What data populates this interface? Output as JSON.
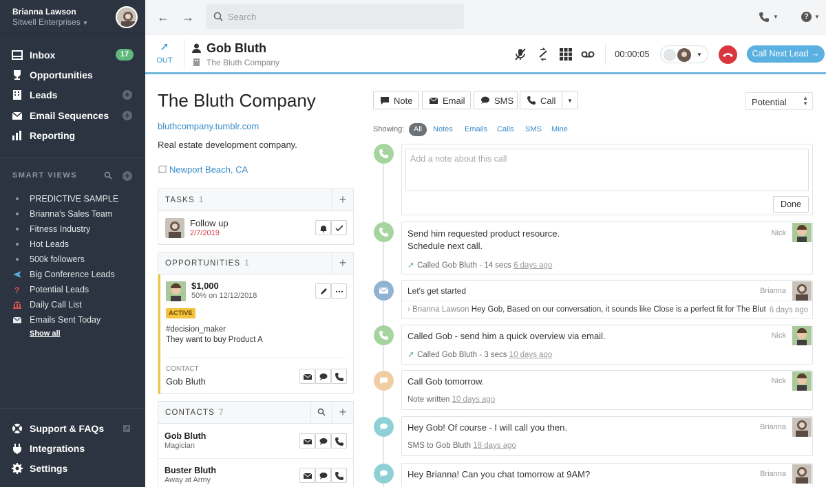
{
  "user": {
    "name": "Brianna Lawson",
    "org": "Sitwell Enterprises"
  },
  "sidebar": {
    "nav": [
      {
        "label": "Inbox",
        "badge": "17",
        "icon": "inbox-icon"
      },
      {
        "label": "Opportunities",
        "icon": "trophy-icon"
      },
      {
        "label": "Leads",
        "icon": "building-icon"
      },
      {
        "label": "Email Sequences",
        "icon": "email-sequences-icon"
      },
      {
        "label": "Reporting",
        "icon": "bar-chart-icon"
      }
    ],
    "smart_views_heading": "SMART VIEWS",
    "smart_views": [
      {
        "label": "PREDICTIVE SAMPLE",
        "icon": "dot"
      },
      {
        "label": "Brianna's Sales Team",
        "icon": "dot"
      },
      {
        "label": "Fitness Industry",
        "icon": "dot"
      },
      {
        "label": "Hot Leads",
        "icon": "dot"
      },
      {
        "label": "500k followers",
        "icon": "dot"
      },
      {
        "label": "Big Conference Leads",
        "icon": "airplane-icon"
      },
      {
        "label": "Potential Leads",
        "icon": "question-icon"
      },
      {
        "label": "Daily Call List",
        "icon": "building-columns-icon"
      },
      {
        "label": "Emails Sent Today",
        "icon": "envelope-icon"
      }
    ],
    "show_all": "Show all",
    "bottom": [
      {
        "label": "Support & FAQs",
        "icon": "lifebuoy-icon"
      },
      {
        "label": "Integrations",
        "icon": "plug-icon"
      },
      {
        "label": "Settings",
        "icon": "gear-icon"
      }
    ]
  },
  "topbar": {
    "search_placeholder": "Search"
  },
  "callbar": {
    "direction": "OUT",
    "lead_name": "Gob Bluth",
    "lead_company": "The Bluth Company",
    "timer": "00:00:05",
    "call_next": "Call Next Lead →"
  },
  "company": {
    "title": "The Bluth Company",
    "url": "bluthcompany.tumblr.com",
    "description": "Real estate development company.",
    "location": "Newport Beach, CA"
  },
  "tasks": {
    "title": "TASKS",
    "count": "1",
    "items": [
      {
        "label": "Follow up",
        "date": "2/7/2019"
      }
    ]
  },
  "opportunities": {
    "title": "OPPORTUNITIES",
    "count": "1",
    "item": {
      "value": "$1,000",
      "detail": "50% on 12/12/2018",
      "status": "ACTIVE",
      "tag": "#decision_maker",
      "note": "They want to buy Product A",
      "contact_label": "CONTACT",
      "contact_name": "Gob Bluth"
    }
  },
  "contacts": {
    "title": "CONTACTS",
    "count": "7",
    "items": [
      {
        "name": "Gob Bluth",
        "title": "Magician"
      },
      {
        "name": "Buster Bluth",
        "title": "Away at Army"
      }
    ]
  },
  "activity": {
    "tabs": [
      "Note",
      "Email",
      "SMS",
      "Call"
    ],
    "status": "Potential",
    "showing_label": "Showing:",
    "filters": [
      "All",
      "Notes",
      "Emails",
      "Calls",
      "SMS",
      "Mine"
    ],
    "note_placeholder": "Add a note about this call",
    "done": "Done",
    "items": [
      {
        "type": "call",
        "lines": [
          "Send him requested product resource.",
          "Schedule next call."
        ],
        "meta": "Called Gob Bluth - 14 secs",
        "ago": "6 days ago",
        "who": "Nick"
      },
      {
        "type": "email",
        "subject": "Let's get started",
        "from": "Brianna Lawson",
        "preview": "Hey Gob, Based on our conversation, it sounds like Close is a perfect fit for The Blut…",
        "ago": "6 days ago",
        "who": "Brianna"
      },
      {
        "type": "call",
        "lines": [
          "Called Gob - send him a quick overview via email."
        ],
        "meta": "Called Gob Bluth - 3 secs",
        "ago": "10 days ago",
        "who": "Nick"
      },
      {
        "type": "note",
        "lines": [
          "Call Gob tomorrow."
        ],
        "meta": "Note written",
        "ago": "10 days ago",
        "who": "Nick"
      },
      {
        "type": "sms",
        "lines": [
          "Hey Gob! Of course - I will call you then."
        ],
        "meta": "SMS to Gob Bluth",
        "ago": "18 days ago",
        "who": "Brianna"
      },
      {
        "type": "sms",
        "lines": [
          "Hey Brianna! Can you chat tomorrow at 9AM?"
        ],
        "who": "Brianna"
      }
    ]
  },
  "colors": {
    "sidebar": "#2b3440",
    "accent": "#3a8cc9",
    "call_green": "#a6d49f",
    "email_blue": "#8fb3d1",
    "note_orange": "#f0cda3",
    "sms_teal": "#8fd0d7",
    "hangup": "#d9363e"
  }
}
